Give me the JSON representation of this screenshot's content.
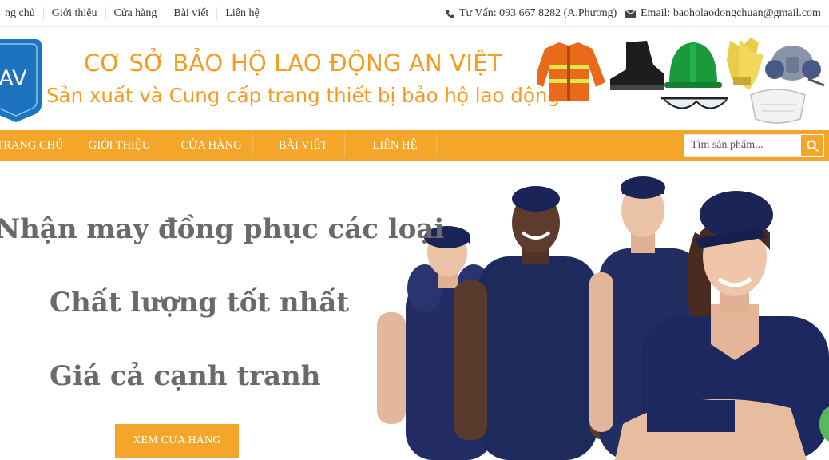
{
  "topbar": {
    "nav": [
      "ng chủ",
      "Giới thiệu",
      "Cửa hàng",
      "Bài viết",
      "Liên hệ"
    ],
    "phone": "Tư Vấn: 093 667 8282 (A.Phương)",
    "email": "Email: baoholaodongchuan@gmail.com"
  },
  "header": {
    "logo_text": "AV",
    "title": "CƠ SỞ BẢO HỘ LAO ĐỘNG AN VIỆT",
    "subtitle": "Sản xuất và Cung cấp trang thiết bị bảo hộ lao động"
  },
  "nav": {
    "items": [
      "TRANG CHỦ",
      "GIỚI THIỆU",
      "CỬA HÀNG",
      "BÀI VIẾT",
      "LIÊN HỆ"
    ]
  },
  "search": {
    "placeholder": "Tìm sản phẩm..."
  },
  "hero": {
    "line1": "Nhận may đồng phục các loại",
    "line2": "Chất lượng tốt nhất",
    "line3": "Giá cả cạnh tranh",
    "cta": "XEM CỬA HÀNG"
  },
  "colors": {
    "accent": "#f4a62a",
    "title_orange": "#f39c1f",
    "hero_text": "#6a6a6a",
    "logo_blue": "#1e73be",
    "uniform_navy": "#1f2a5c"
  }
}
